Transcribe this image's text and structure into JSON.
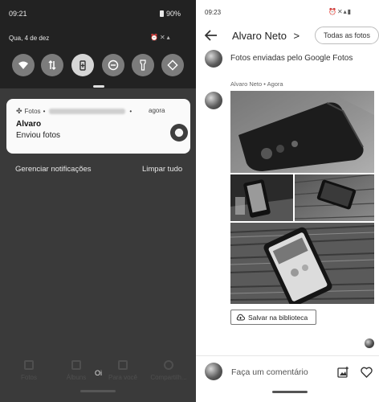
{
  "left": {
    "status": {
      "time": "09:21",
      "battery": "90%"
    },
    "date": "Qua, 4 de dez",
    "quick_tiles": [
      "wifi-icon",
      "data-transfer-icon",
      "battery-saver-icon",
      "do-not-disturb-icon",
      "flashlight-icon",
      "auto-rotate-icon"
    ],
    "notification": {
      "app": "Fotos",
      "sep1": "•",
      "sep2": "•",
      "time": "agora",
      "title": "Alvaro",
      "text": "Enviou fotos"
    },
    "manage": "Gerenciar notificações",
    "clear": "Limpar tudo",
    "bottom_nav": [
      {
        "label": "Fotos",
        "icon": "photo-icon"
      },
      {
        "label": "Álbuns",
        "icon": "albums-icon"
      },
      {
        "label": "Para você",
        "icon": "for-you-icon"
      },
      {
        "label": "Compartilh...",
        "icon": "sharing-icon"
      }
    ],
    "oi": "Oi"
  },
  "right": {
    "status": {
      "time": "09:23"
    },
    "title": "Alvaro Neto",
    "chevron": ">",
    "all_photos": "Todas as fotos",
    "header_msg": "Fotos enviadas pelo Google Fotos",
    "meta": "Alvaro Neto • Agora",
    "save": "Salvar na biblioteca",
    "comment_placeholder": "Faça um comentário"
  },
  "colors": {
    "dark_shade": "#222222",
    "panel_bg": "#3a3a3a",
    "card": "#fafafa"
  }
}
